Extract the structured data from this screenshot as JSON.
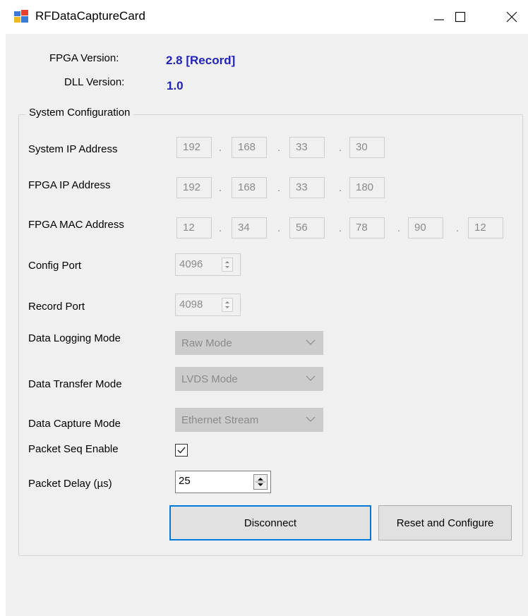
{
  "window": {
    "title": "RFDataCaptureCard",
    "minimize_icon": "minimize-icon",
    "maximize_icon": "maximize-icon",
    "close_icon": "close-icon",
    "app_icon": "form-app-icon"
  },
  "versions": {
    "fpga_label": "FPGA Version:",
    "fpga_value": "2.8 [Record]",
    "dll_label": "DLL Version:",
    "dll_value": "1.0",
    "value_color": "#2323b8"
  },
  "system_config": {
    "legend": "System Configuration",
    "system_ip": {
      "label": "System IP Address",
      "octets": [
        "192",
        "168",
        "33",
        "30"
      ],
      "separator": "."
    },
    "fpga_ip": {
      "label": "FPGA IP Address",
      "octets": [
        "192",
        "168",
        "33",
        "180"
      ],
      "separator": "."
    },
    "fpga_mac": {
      "label": "FPGA MAC Address",
      "octets": [
        "12",
        "34",
        "56",
        "78",
        "90",
        "12"
      ],
      "separator": "."
    },
    "config_port": {
      "label": "Config Port",
      "value": "4096"
    },
    "record_port": {
      "label": "Record Port",
      "value": "4098"
    },
    "data_logging_mode": {
      "label": "Data Logging Mode",
      "value": "Raw Mode"
    },
    "data_transfer_mode": {
      "label": "Data Transfer Mode",
      "value": "LVDS Mode"
    },
    "data_capture_mode": {
      "label": "Data Capture Mode",
      "value": "Ethernet Stream"
    },
    "packet_seq_enable": {
      "label": "Packet Seq Enable",
      "checked": true
    },
    "packet_delay": {
      "label": "Packet Delay (µs)",
      "value": "25"
    }
  },
  "buttons": {
    "disconnect": "Disconnect",
    "reset_configure": "Reset and Configure"
  }
}
